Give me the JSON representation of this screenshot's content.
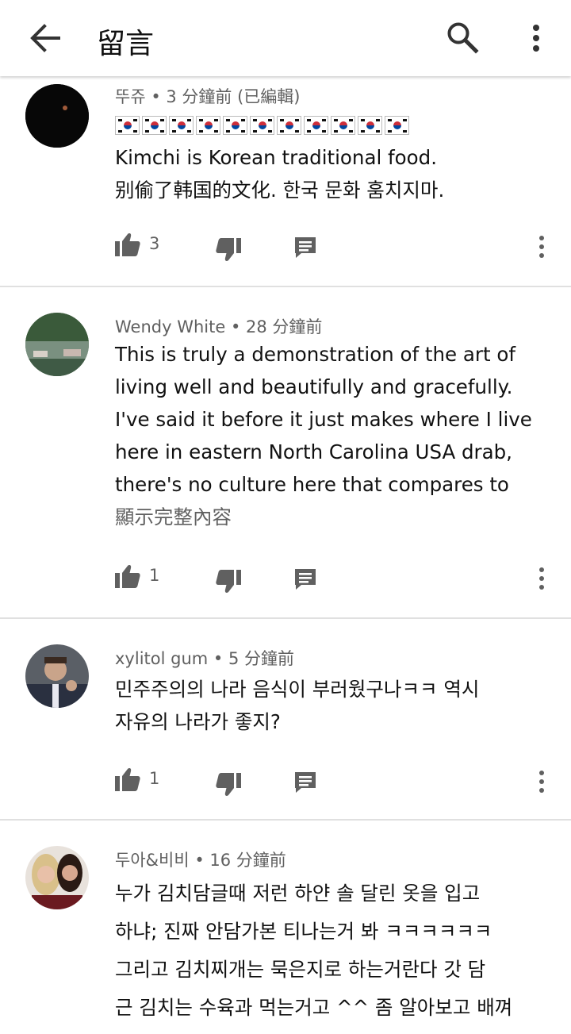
{
  "header": {
    "title": "留言"
  },
  "comments": [
    {
      "author": "뚜쥬",
      "time": "3 分鐘前 (已編輯)",
      "flag_count": 11,
      "lines": [
        "Kimchi is Korean traditional food.",
        "别偷了韩国的文化. 한국 문화 훔치지마."
      ],
      "likes": "3"
    },
    {
      "author": "Wendy White",
      "time": "28 分鐘前",
      "lines": [
        "This is truly a demonstration of the art of",
        "living well and beautifully and gracefully.",
        "I've said it before it just makes where I live",
        "here in eastern North Carolina USA drab,",
        "there's no culture here that compares to"
      ],
      "show_more": "顯示完整內容",
      "likes": "1"
    },
    {
      "author": "xylitol gum",
      "time": "5 分鐘前",
      "lines": [
        "민주주의의 나라 음식이 부러웠구나ㅋㅋ 역시",
        "자유의 나라가 좋지?"
      ],
      "likes": "1"
    },
    {
      "author": "두아&비비",
      "time": "16 分鐘前",
      "lines": [
        "누가 김치담글때 저런 하얀 솔 달린 옷을 입고",
        "하냐; 진짜 안담가본 티나는거 봐 ㅋㅋㅋㅋㅋㅋ",
        "그리고 김치찌개는 묵은지로 하는거란다 갓 담",
        "근 김치는 수육과 먹는거고 ^^ 좀 알아보고 배껴"
      ]
    }
  ],
  "meta_separator": " • ",
  "colors": {
    "secondary_text": "#606060",
    "icon": "#606060",
    "divider": "#e0e0e0"
  },
  "icons": [
    "back-arrow-icon",
    "search-icon",
    "more-vert-icon",
    "thumb-up-icon",
    "thumb-down-icon",
    "reply-icon"
  ]
}
